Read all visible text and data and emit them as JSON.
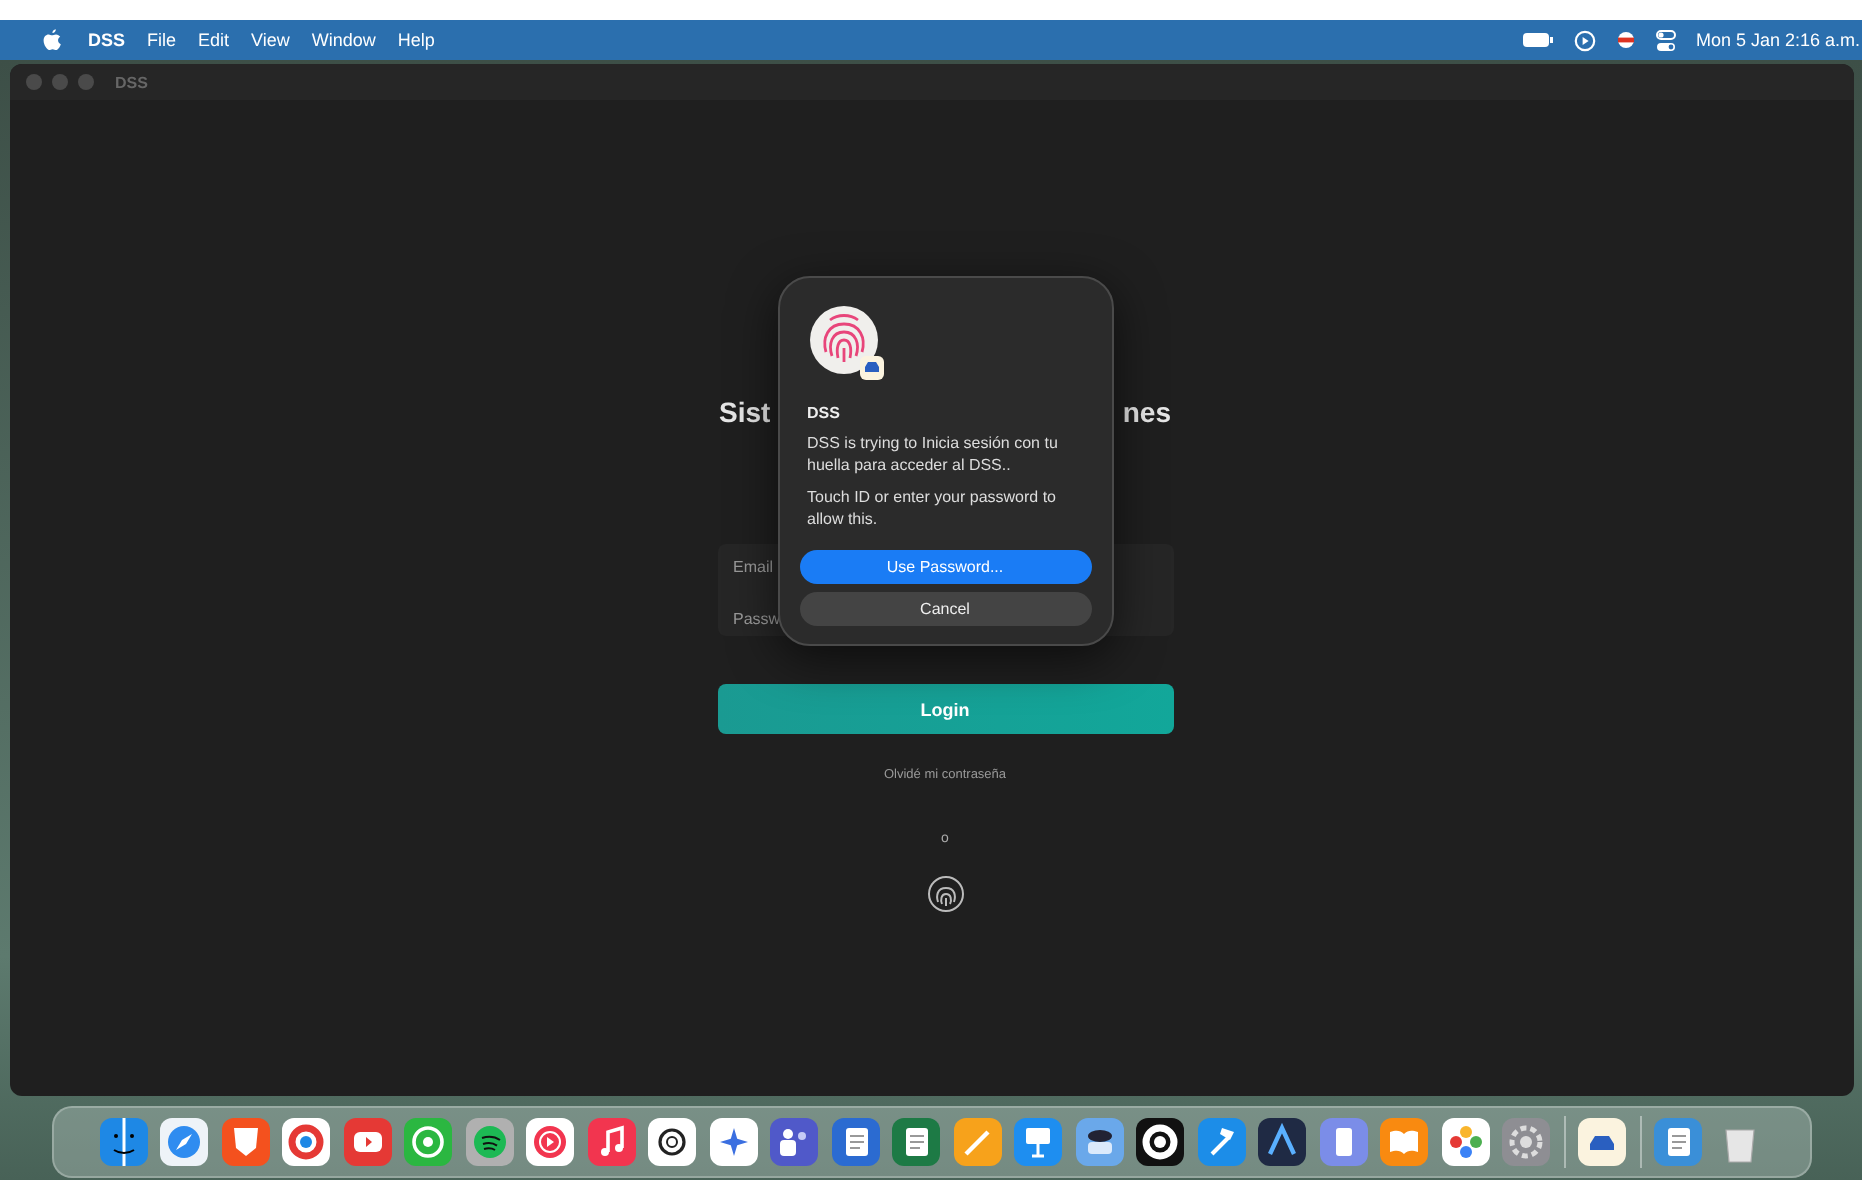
{
  "menu_bar": {
    "app": "DSS",
    "menus": [
      "File",
      "Edit",
      "View",
      "Window",
      "Help"
    ],
    "clock": "Mon 5 Jan 2:16 a.m."
  },
  "window": {
    "title": "DSS"
  },
  "login": {
    "heading_visible_start": "Sist",
    "heading_visible_end": "nes",
    "fields": [
      {
        "label": "Email"
      },
      {
        "label": "Passw"
      }
    ],
    "login_button": "Login",
    "forgot_link": "Olvidé mi contraseña",
    "separator": "o"
  },
  "auth_dialog": {
    "app_name": "DSS",
    "message": "DSS is trying to Inicia sesión con tu huella para acceder al DSS..",
    "hint": "Touch ID or enter your password to allow this.",
    "buttons": [
      {
        "label": "Use Password...",
        "selected": true
      },
      {
        "label": "Cancel",
        "selected": false
      }
    ]
  }
}
